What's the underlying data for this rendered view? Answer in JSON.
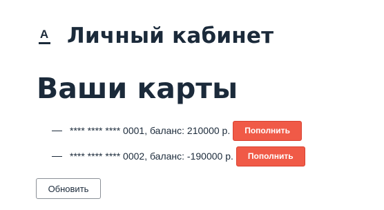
{
  "header": {
    "logo_letter": "A",
    "title": "Личный кабинет"
  },
  "page_heading": "Ваши карты",
  "cards": [
    {
      "text": "**** **** **** 0001, баланс: 210000 р.",
      "button_label": "Пополнить"
    },
    {
      "text": "**** **** **** 0002, баланс: -190000 р.",
      "button_label": "Пополнить"
    }
  ],
  "refresh_label": "Обновить",
  "colors": {
    "text": "#1b2a3a",
    "accent_button": "#f05a47"
  }
}
